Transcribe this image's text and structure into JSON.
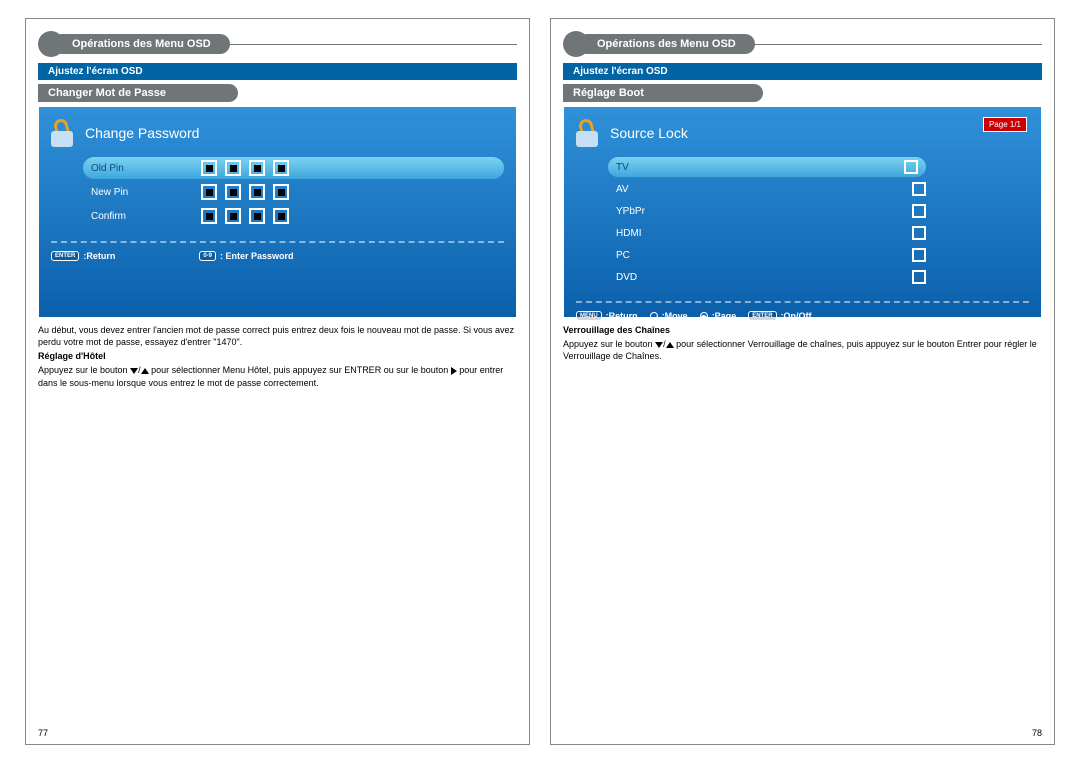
{
  "left": {
    "top_header": "Opérations des Menu OSD",
    "blue_bar": "Ajustez l'écran OSD",
    "sub_header": "Changer Mot de Passe",
    "screen_title": "Change Password",
    "rows": {
      "old": "Old Pin",
      "new": "New Pin",
      "confirm": "Confirm"
    },
    "hints": {
      "enter_key": "ENTER",
      "return": ":Return",
      "num_key": "0-9",
      "enter_pw": ": Enter Password"
    },
    "text1": "Au début, vous devez entrer l'ancien mot de passe correct puis entrez deux fois le nouveau mot de passe. Si vous avez perdu votre mot de passe, essayez d'entrer \"1470\".",
    "bold1": "Réglage d'Hôtel",
    "text2a": "Appuyez sur le bouton ",
    "text2b": " pour sélectionner Menu Hôtel, puis appuyez sur ENTRER ou sur le bouton ",
    "text2c": " pour entrer dans le sous-menu lorsque vous entrez le mot de passe correctement.",
    "page_num": "77"
  },
  "right": {
    "top_header": "Opérations des Menu OSD",
    "blue_bar": "Ajustez l'écran OSD",
    "sub_header": "Réglage Boot",
    "screen_title": "Source Lock",
    "page_badge": "Page 1/1",
    "sources": [
      "TV",
      "AV",
      "YPbPr",
      "HDMI",
      "PC",
      "DVD"
    ],
    "hints": {
      "menu_key": "MENU",
      "return": ":Return",
      "move": ":Move",
      "page": ":Page",
      "enter_key": "ENTER",
      "onoff": ":On/Off"
    },
    "bold1": "Verrouillage des Chaînes",
    "text1a": "Appuyez sur le bouton ",
    "text1b": " pour sélectionner Verrouillage de chaînes, puis appuyez sur le bouton Entrer pour régler le Verrouillage de Chaînes.",
    "page_num": "78"
  }
}
